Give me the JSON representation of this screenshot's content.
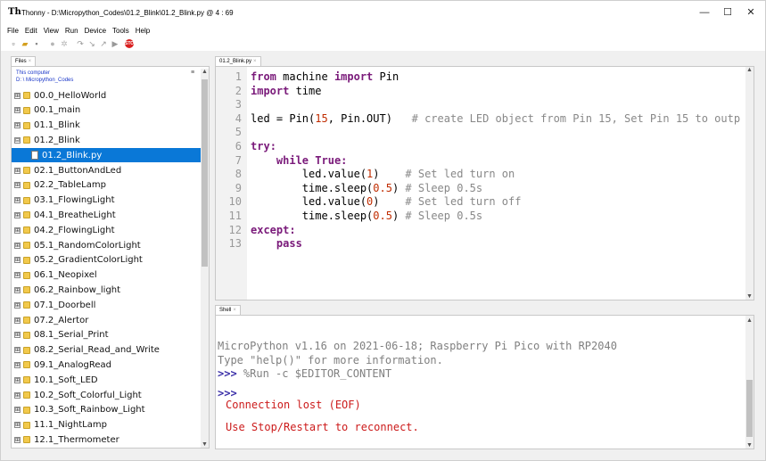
{
  "window": {
    "title": "Thonny  -  D:\\Micropython_Codes\\01.2_Blink\\01.2_Blink.py  @  4 : 69",
    "app_icon": "Th",
    "controls": {
      "minimize": "—",
      "maximize": "☐",
      "close": "✕"
    }
  },
  "menu": [
    "File",
    "Edit",
    "View",
    "Run",
    "Device",
    "Tools",
    "Help"
  ],
  "toolbar": {
    "icons": [
      "new-file-icon",
      "open-file-icon",
      "save-icon",
      "run-icon",
      "debug-icon",
      "step-over-icon",
      "step-into-icon",
      "step-out-icon",
      "resume-icon",
      "stop-icon"
    ],
    "stop_label": "STOP"
  },
  "files_panel": {
    "tab": "Files",
    "tab_close": "×",
    "location_line1": "This computer",
    "location_line2": "D: \\ Micropython_Codes",
    "menu_glyph": "≡",
    "items": [
      {
        "label": "00.0_HelloWorld",
        "type": "folder",
        "expander": "⊞"
      },
      {
        "label": "00.1_main",
        "type": "folder",
        "expander": "⊞"
      },
      {
        "label": "01.1_Blink",
        "type": "folder",
        "expander": "⊞"
      },
      {
        "label": "01.2_Blink",
        "type": "folder",
        "expander": "⊟"
      },
      {
        "label": "01.2_Blink.py",
        "type": "file",
        "selected": true
      },
      {
        "label": "02.1_ButtonAndLed",
        "type": "folder",
        "expander": "⊞"
      },
      {
        "label": "02.2_TableLamp",
        "type": "folder",
        "expander": "⊞"
      },
      {
        "label": "03.1_FlowingLight",
        "type": "folder",
        "expander": "⊞"
      },
      {
        "label": "04.1_BreatheLight",
        "type": "folder",
        "expander": "⊞"
      },
      {
        "label": "04.2_FlowingLight",
        "type": "folder",
        "expander": "⊞"
      },
      {
        "label": "05.1_RandomColorLight",
        "type": "folder",
        "expander": "⊞"
      },
      {
        "label": "05.2_GradientColorLight",
        "type": "folder",
        "expander": "⊞"
      },
      {
        "label": "06.1_Neopixel",
        "type": "folder",
        "expander": "⊞"
      },
      {
        "label": "06.2_Rainbow_light",
        "type": "folder",
        "expander": "⊞"
      },
      {
        "label": "07.1_Doorbell",
        "type": "folder",
        "expander": "⊞"
      },
      {
        "label": "07.2_Alertor",
        "type": "folder",
        "expander": "⊞"
      },
      {
        "label": "08.1_Serial_Print",
        "type": "folder",
        "expander": "⊞"
      },
      {
        "label": "08.2_Serial_Read_and_Write",
        "type": "folder",
        "expander": "⊞"
      },
      {
        "label": "09.1_AnalogRead",
        "type": "folder",
        "expander": "⊞"
      },
      {
        "label": "10.1_Soft_LED",
        "type": "folder",
        "expander": "⊞"
      },
      {
        "label": "10.2_Soft_Colorful_Light",
        "type": "folder",
        "expander": "⊞"
      },
      {
        "label": "10.3_Soft_Rainbow_Light",
        "type": "folder",
        "expander": "⊞"
      },
      {
        "label": "11.1_NightLamp",
        "type": "folder",
        "expander": "⊞"
      },
      {
        "label": "12.1_Thermometer",
        "type": "folder",
        "expander": "⊞"
      }
    ]
  },
  "editor": {
    "tab": "01.2_Blink.py",
    "tab_close": "×",
    "line_numbers": [
      "1",
      "2",
      "3",
      "4",
      "5",
      "6",
      "7",
      "8",
      "9",
      "10",
      "11",
      "12",
      "13"
    ],
    "lines": [
      [
        {
          "t": "from",
          "c": "kw"
        },
        {
          "t": " machine ",
          "c": ""
        },
        {
          "t": "import",
          "c": "kw"
        },
        {
          "t": " Pin",
          "c": ""
        }
      ],
      [
        {
          "t": "import",
          "c": "kw"
        },
        {
          "t": " time",
          "c": ""
        }
      ],
      [],
      [
        {
          "t": "led = Pin(",
          "c": ""
        },
        {
          "t": "15",
          "c": "num"
        },
        {
          "t": ", Pin.OUT)   ",
          "c": ""
        },
        {
          "t": "# create LED object from Pin 15, Set Pin 15 to outp",
          "c": "com"
        }
      ],
      [],
      [
        {
          "t": "try",
          "c": "kw"
        },
        {
          "t": ":",
          "c": "kw"
        }
      ],
      [
        {
          "t": "    ",
          "c": ""
        },
        {
          "t": "while",
          "c": "kw"
        },
        {
          "t": " ",
          "c": ""
        },
        {
          "t": "True",
          "c": "kw"
        },
        {
          "t": ":",
          "c": "kw"
        }
      ],
      [
        {
          "t": "        led.value(",
          "c": ""
        },
        {
          "t": "1",
          "c": "num"
        },
        {
          "t": ")    ",
          "c": ""
        },
        {
          "t": "# Set led turn on",
          "c": "com"
        }
      ],
      [
        {
          "t": "        time.sleep(",
          "c": ""
        },
        {
          "t": "0.5",
          "c": "num"
        },
        {
          "t": ") ",
          "c": ""
        },
        {
          "t": "# Sleep 0.5s",
          "c": "com"
        }
      ],
      [
        {
          "t": "        led.value(",
          "c": ""
        },
        {
          "t": "0",
          "c": "num"
        },
        {
          "t": ")    ",
          "c": ""
        },
        {
          "t": "# Set led turn off",
          "c": "com"
        }
      ],
      [
        {
          "t": "        time.sleep(",
          "c": ""
        },
        {
          "t": "0.5",
          "c": "num"
        },
        {
          "t": ") ",
          "c": ""
        },
        {
          "t": "# Sleep 0.5s",
          "c": "com"
        }
      ],
      [
        {
          "t": "except",
          "c": "kw"
        },
        {
          "t": ":",
          "c": "kw"
        }
      ],
      [
        {
          "t": "    ",
          "c": ""
        },
        {
          "t": "pass",
          "c": "kw"
        }
      ]
    ]
  },
  "shell": {
    "tab": "Shell",
    "tab_close": "×",
    "banner1": "MicroPython v1.16 on 2021-06-18; Raspberry Pi Pico with RP2040",
    "banner2": "Type \"help()\" for more information.",
    "prompt1": ">>> ",
    "command": "%Run -c $EDITOR_CONTENT",
    "prompt2": ">>>",
    "error1": "Connection lost (EOF)",
    "error2": "Use Stop/Restart to reconnect."
  },
  "colors": {
    "selection": "#0a78d7",
    "keyword": "#7a1a7a",
    "number": "#c02c00",
    "comment": "#888888",
    "error": "#cc1b1b",
    "prompt": "#3a2fa8"
  }
}
